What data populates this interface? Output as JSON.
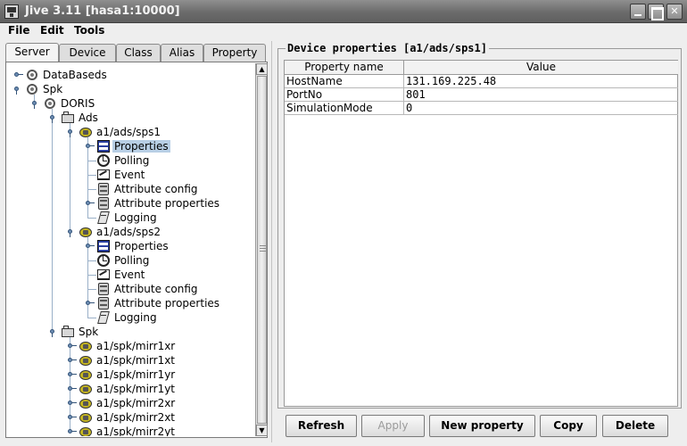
{
  "window": {
    "title": "Jive 3.11  [hasa1:10000]"
  },
  "menu": {
    "file": "File",
    "edit": "Edit",
    "tools": "Tools"
  },
  "tabs": [
    {
      "label": "Server",
      "active": true
    },
    {
      "label": "Device",
      "active": false
    },
    {
      "label": "Class",
      "active": false
    },
    {
      "label": "Alias",
      "active": false
    },
    {
      "label": "Property",
      "active": false
    }
  ],
  "tree": [
    {
      "label": "DataBaseds",
      "icon": "server-icon",
      "depth": 0,
      "expanded": false,
      "selected": false
    },
    {
      "label": "Spk",
      "icon": "server-icon",
      "depth": 0,
      "expanded": true,
      "selected": false
    },
    {
      "label": "DORIS",
      "icon": "server-icon",
      "depth": 1,
      "expanded": true,
      "selected": false
    },
    {
      "label": "Ads",
      "icon": "class-folder-icon",
      "depth": 2,
      "expanded": true,
      "selected": false
    },
    {
      "label": "a1/ads/sps1",
      "icon": "device-icon",
      "depth": 3,
      "expanded": true,
      "selected": false
    },
    {
      "label": "Properties",
      "icon": "properties-icon",
      "depth": 4,
      "expanded": false,
      "selected": true
    },
    {
      "label": "Polling",
      "icon": "polling-icon",
      "depth": 4,
      "expanded": null,
      "selected": false
    },
    {
      "label": "Event",
      "icon": "event-icon",
      "depth": 4,
      "expanded": null,
      "selected": false
    },
    {
      "label": "Attribute config",
      "icon": "attribute-config-icon",
      "depth": 4,
      "expanded": null,
      "selected": false
    },
    {
      "label": "Attribute properties",
      "icon": "attribute-properties-icon",
      "depth": 4,
      "expanded": false,
      "selected": false
    },
    {
      "label": "Logging",
      "icon": "logging-icon",
      "depth": 4,
      "expanded": null,
      "selected": false
    },
    {
      "label": "a1/ads/sps2",
      "icon": "device-icon",
      "depth": 3,
      "expanded": true,
      "selected": false
    },
    {
      "label": "Properties",
      "icon": "properties-icon",
      "depth": 4,
      "expanded": false,
      "selected": false
    },
    {
      "label": "Polling",
      "icon": "polling-icon",
      "depth": 4,
      "expanded": null,
      "selected": false
    },
    {
      "label": "Event",
      "icon": "event-icon",
      "depth": 4,
      "expanded": null,
      "selected": false
    },
    {
      "label": "Attribute config",
      "icon": "attribute-config-icon",
      "depth": 4,
      "expanded": null,
      "selected": false
    },
    {
      "label": "Attribute properties",
      "icon": "attribute-properties-icon",
      "depth": 4,
      "expanded": false,
      "selected": false
    },
    {
      "label": "Logging",
      "icon": "logging-icon",
      "depth": 4,
      "expanded": null,
      "selected": false
    },
    {
      "label": "Spk",
      "icon": "class-folder-icon",
      "depth": 2,
      "expanded": true,
      "selected": false
    },
    {
      "label": "a1/spk/mirr1xr",
      "icon": "device-icon",
      "depth": 3,
      "expanded": false,
      "selected": false
    },
    {
      "label": "a1/spk/mirr1xt",
      "icon": "device-icon",
      "depth": 3,
      "expanded": false,
      "selected": false
    },
    {
      "label": "a1/spk/mirr1yr",
      "icon": "device-icon",
      "depth": 3,
      "expanded": false,
      "selected": false
    },
    {
      "label": "a1/spk/mirr1yt",
      "icon": "device-icon",
      "depth": 3,
      "expanded": false,
      "selected": false
    },
    {
      "label": "a1/spk/mirr2xr",
      "icon": "device-icon",
      "depth": 3,
      "expanded": false,
      "selected": false
    },
    {
      "label": "a1/spk/mirr2xt",
      "icon": "device-icon",
      "depth": 3,
      "expanded": false,
      "selected": false
    },
    {
      "label": "a1/spk/mirr2yt",
      "icon": "device-icon",
      "depth": 3,
      "expanded": false,
      "selected": false
    }
  ],
  "panel": {
    "title": "Device properties [a1/ads/sps1]",
    "columns": [
      "Property name",
      "Value"
    ],
    "rows": [
      {
        "name": "HostName",
        "value": "131.169.225.48"
      },
      {
        "name": "PortNo",
        "value": "801"
      },
      {
        "name": "SimulationMode",
        "value": "0"
      }
    ]
  },
  "buttons": {
    "refresh": "Refresh",
    "apply": "Apply",
    "new_property": "New property",
    "copy": "Copy",
    "delete": "Delete"
  },
  "colors": {
    "selection": "#b8cfe5",
    "titlebar": "#6b6b6b"
  }
}
